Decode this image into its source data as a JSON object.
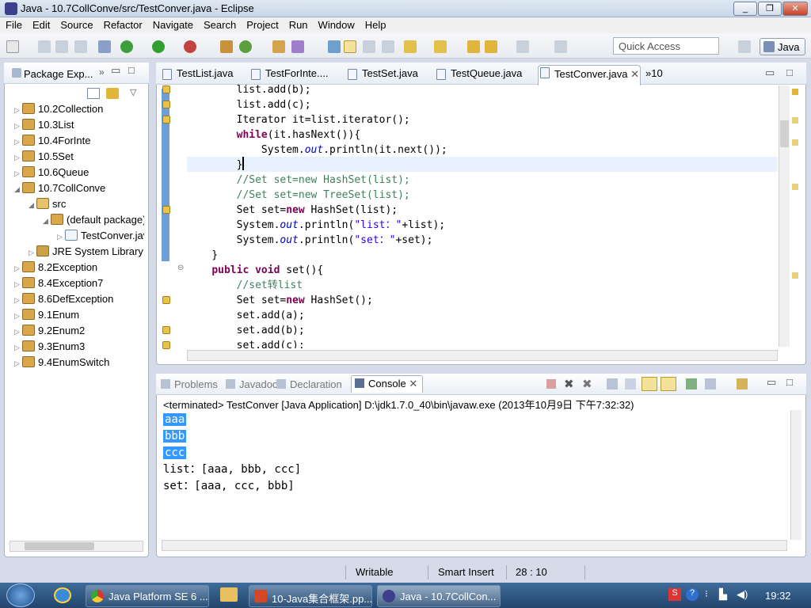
{
  "window": {
    "title": "Java - 10.7CollConve/src/TestConver.java - Eclipse",
    "min": "_",
    "max": "❐",
    "close": "✕"
  },
  "menu": [
    "File",
    "Edit",
    "Source",
    "Refactor",
    "Navigate",
    "Search",
    "Project",
    "Run",
    "Window",
    "Help"
  ],
  "toolbar": {
    "quick_access": "Quick Access",
    "perspective": "Java"
  },
  "package_explorer": {
    "title": "Package Exp...",
    "items": [
      {
        "label": "10.2Collection",
        "level": 0,
        "exp": "▷"
      },
      {
        "label": "10.3List",
        "level": 0,
        "exp": "▷"
      },
      {
        "label": "10.4ForInte",
        "level": 0,
        "exp": "▷"
      },
      {
        "label": "10.5Set",
        "level": 0,
        "exp": "▷"
      },
      {
        "label": "10.6Queue",
        "level": 0,
        "exp": "▷"
      },
      {
        "label": "10.7CollConve",
        "level": 0,
        "exp": "◢"
      },
      {
        "label": "src",
        "level": 1,
        "exp": "◢"
      },
      {
        "label": "(default package)",
        "level": 2,
        "exp": "◢"
      },
      {
        "label": "TestConver.java",
        "level": 3,
        "exp": "▷"
      },
      {
        "label": "JRE System Library",
        "level": 1,
        "exp": "▷"
      },
      {
        "label": "8.2Exception",
        "level": 0,
        "exp": "▷"
      },
      {
        "label": "8.4Exception7",
        "level": 0,
        "exp": "▷"
      },
      {
        "label": "8.6DefException",
        "level": 0,
        "exp": "▷"
      },
      {
        "label": "9.1Enum",
        "level": 0,
        "exp": "▷"
      },
      {
        "label": "9.2Enum2",
        "level": 0,
        "exp": "▷"
      },
      {
        "label": "9.3Enum3",
        "level": 0,
        "exp": "▷"
      },
      {
        "label": "9.4EnumSwitch",
        "level": 0,
        "exp": "▷"
      }
    ]
  },
  "editor": {
    "tabs": [
      "TestList.java",
      "TestForInte....",
      "TestSet.java",
      "TestQueue.java",
      "TestConver.java"
    ],
    "overflow": "»10",
    "lines": [
      [
        {
          "t": "        list.add(b);"
        }
      ],
      [
        {
          "t": "        list.add(c);"
        }
      ],
      [
        {
          "t": "        Iterator it=list.iterator();"
        }
      ],
      [
        {
          "t": "        "
        },
        {
          "t": "while",
          "c": "kw"
        },
        {
          "t": "(it.hasNext()){"
        }
      ],
      [
        {
          "t": "            System."
        },
        {
          "t": "out",
          "c": "it"
        },
        {
          "t": ".println(it.next());"
        }
      ],
      [
        {
          "t": "        }"
        }
      ],
      [
        {
          "t": "        //Set set=new HashSet(list);",
          "c": "cm"
        }
      ],
      [
        {
          "t": "        //Set set=new TreeSet(list);",
          "c": "cm"
        }
      ],
      [
        {
          "t": "        Set set="
        },
        {
          "t": "new",
          "c": "kw"
        },
        {
          "t": " HashSet(list);"
        }
      ],
      [
        {
          "t": "        System."
        },
        {
          "t": "out",
          "c": "it"
        },
        {
          "t": ".println("
        },
        {
          "t": "\"list：\"",
          "c": "st"
        },
        {
          "t": "+list);"
        }
      ],
      [
        {
          "t": "        System."
        },
        {
          "t": "out",
          "c": "it"
        },
        {
          "t": ".println("
        },
        {
          "t": "\"set：\"",
          "c": "st"
        },
        {
          "t": "+set);"
        }
      ],
      [
        {
          "t": "    }"
        }
      ],
      [
        {
          "t": "    "
        },
        {
          "t": "public",
          "c": "kw"
        },
        {
          "t": " "
        },
        {
          "t": "void",
          "c": "kw"
        },
        {
          "t": " set(){"
        }
      ],
      [
        {
          "t": "        //set转list",
          "c": "cm"
        }
      ],
      [
        {
          "t": "        Set set="
        },
        {
          "t": "new",
          "c": "kw"
        },
        {
          "t": " HashSet();"
        }
      ],
      [
        {
          "t": "        set.add(a);"
        }
      ],
      [
        {
          "t": "        set.add(b);"
        }
      ],
      [
        {
          "t": "        set.add(c);"
        }
      ]
    ]
  },
  "console": {
    "tabs": [
      "Problems",
      "Javadoc",
      "Declaration",
      "Console"
    ],
    "header": "<terminated> TestConver [Java Application] D:\\jdk1.7.0_40\\bin\\javaw.exe (2013年10月9日 下午7:32:32)",
    "selected_lines": [
      "aaa",
      "bbb",
      "ccc"
    ],
    "lines": [
      "list：[aaa, bbb, ccc]",
      "set：[aaa, ccc, bbb]"
    ]
  },
  "status": {
    "writable": "Writable",
    "insert_mode": "Smart Insert",
    "position": "28 : 10"
  },
  "taskbar": {
    "items": [
      "Java Platform SE 6 ...",
      "10-Java集合框架.pp...",
      "Java - 10.7CollCon..."
    ],
    "clock": "19:32"
  }
}
